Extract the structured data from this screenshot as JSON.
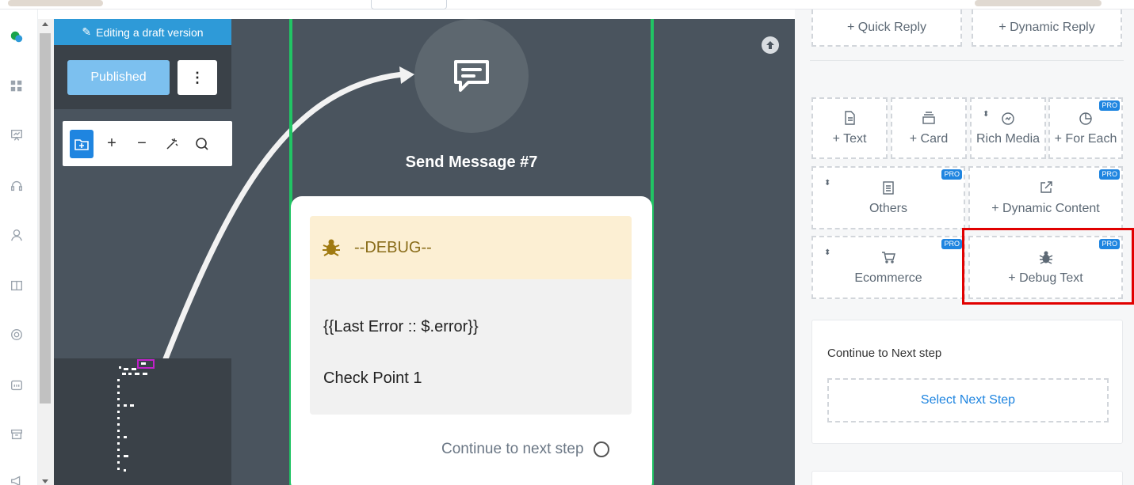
{
  "draft_banner": "Editing a draft version",
  "published_button": "Published",
  "more_button": "⋮",
  "node": {
    "title": "Send Message #7",
    "debug_heading": "--DEBUG--",
    "debug_line1": "{{Last Error :: $.error}}",
    "debug_line2": "Check Point 1",
    "continue": "Continue to next step"
  },
  "panel": {
    "quick_reply": "+ Quick Reply",
    "dynamic_reply": "+ Dynamic Reply",
    "text": "+ Text",
    "card": "+ Card",
    "rich_media": "Rich Media",
    "for_each": "+ For Each",
    "others": "Others",
    "dynamic_content": "+ Dynamic Content",
    "ecommerce": "Ecommerce",
    "debug_text": "+ Debug Text",
    "pro": "PRO",
    "continue_label": "Continue to Next step",
    "select_next_step": "Select Next Step"
  },
  "colors": {
    "accent": "#1f85e0",
    "node_border": "#21c464",
    "highlight": "#e10000"
  }
}
